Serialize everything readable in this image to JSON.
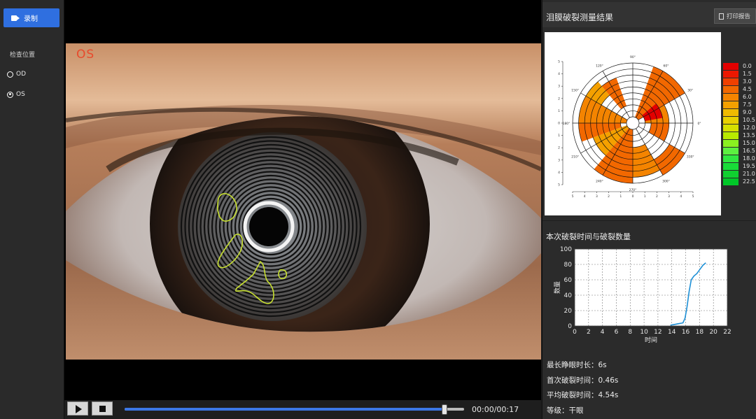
{
  "left_panel": {
    "record_label": "录制",
    "section_title": "检查位置",
    "radio_options": [
      {
        "label": "OD",
        "selected": false
      },
      {
        "label": "OS",
        "selected": true
      }
    ]
  },
  "video": {
    "eye_label": "OS",
    "time_text": "00:00/00:17",
    "progress_fraction": 0.94
  },
  "right_panel": {
    "title": "泪膜破裂测量结果",
    "print_label": "打印报告",
    "polar_map": {
      "axis_ticks": [
        "5",
        "4",
        "3",
        "2",
        "1",
        "0",
        "1",
        "2",
        "3",
        "4",
        "5"
      ],
      "angle_labels": [
        "0°",
        "30°",
        "60°",
        "90°",
        "120°",
        "150°",
        "180°",
        "210°",
        "240°",
        "270°",
        "300°",
        "330°"
      ]
    },
    "color_scale": [
      {
        "value": "0.0",
        "color": "#e30000"
      },
      {
        "value": "1.5",
        "color": "#ec1800"
      },
      {
        "value": "3.0",
        "color": "#f04000"
      },
      {
        "value": "4.5",
        "color": "#f26800"
      },
      {
        "value": "6.0",
        "color": "#f48400"
      },
      {
        "value": "7.5",
        "color": "#f4a000"
      },
      {
        "value": "9.0",
        "color": "#f0ba00"
      },
      {
        "value": "10.5",
        "color": "#e8d000"
      },
      {
        "value": "12.0",
        "color": "#d6e000"
      },
      {
        "value": "13.5",
        "color": "#b8ea00"
      },
      {
        "value": "15.0",
        "color": "#8af020"
      },
      {
        "value": "16.5",
        "color": "#5cf040"
      },
      {
        "value": "18.0",
        "color": "#30e840"
      },
      {
        "value": "19.5",
        "color": "#18dc38"
      },
      {
        "value": "21.0",
        "color": "#10d030"
      },
      {
        "value": "22.5",
        "color": "#00c828"
      }
    ],
    "chart_title": "本次破裂时间与破裂数量",
    "stats": [
      "最长睁眼时长：6s",
      "首次破裂时间：0.46s",
      "平均破裂时间：4.54s",
      "等级：干眼"
    ]
  },
  "chart_data": {
    "type": "line",
    "title": "本次破裂时间与破裂数量",
    "xlabel": "时间",
    "ylabel": "数量",
    "xlim": [
      0,
      22
    ],
    "ylim": [
      0,
      100
    ],
    "xticks": [
      0,
      2,
      4,
      6,
      8,
      10,
      12,
      14,
      16,
      18,
      20,
      22
    ],
    "yticks": [
      0,
      20,
      40,
      60,
      80,
      100
    ],
    "grid": true,
    "series": [
      {
        "color": "#1e90d6",
        "x": [
          13.8,
          14.4,
          15.0,
          15.6,
          15.9,
          16.2,
          16.5,
          16.8,
          17.2,
          17.6,
          18.0,
          18.5,
          18.9
        ],
        "y": [
          1,
          2,
          3,
          4,
          10,
          25,
          45,
          60,
          65,
          68,
          73,
          79,
          82
        ]
      }
    ]
  },
  "colors": {
    "accent": "#2f6fe0",
    "eye_label": "#e84a2c",
    "contour": "#c8e030"
  }
}
